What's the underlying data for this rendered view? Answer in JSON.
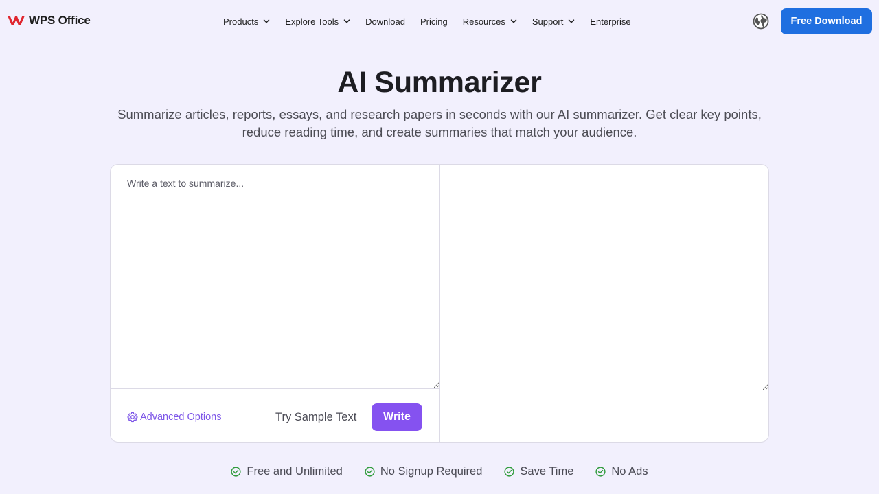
{
  "header": {
    "logo": {
      "text": "WPS Office",
      "icon": "wps-logo-icon",
      "color": "#e0262f"
    },
    "nav": [
      {
        "label": "Products",
        "has_dropdown": true
      },
      {
        "label": "Explore Tools",
        "has_dropdown": true
      },
      {
        "label": "Download",
        "has_dropdown": false
      },
      {
        "label": "Pricing",
        "has_dropdown": false
      },
      {
        "label": "Resources",
        "has_dropdown": true
      },
      {
        "label": "Support",
        "has_dropdown": true
      },
      {
        "label": "Enterprise",
        "has_dropdown": false
      }
    ],
    "language_icon": "globe-icon",
    "cta_label": "Free Download"
  },
  "hero": {
    "title": "AI Summarizer",
    "subtitle": "Summarize articles, reports, essays, and research papers in seconds with our AI summarizer. Get clear key points, reduce reading time, and create summaries that match your audience."
  },
  "editor": {
    "input": {
      "value": "",
      "placeholder": "Write a text to summarize..."
    },
    "output": {
      "value": ""
    },
    "advanced_label": "Advanced Options",
    "sample_label": "Try Sample Text",
    "write_label": "Write"
  },
  "features": [
    {
      "label": "Free and Unlimited",
      "icon": "check-circle-icon"
    },
    {
      "label": "No Signup Required",
      "icon": "check-circle-icon"
    },
    {
      "label": "Save Time",
      "icon": "check-circle-icon"
    },
    {
      "label": "No Ads",
      "icon": "check-circle-icon"
    }
  ],
  "colors": {
    "background": "#f2f0fd",
    "primary_blue": "#1f6fe0",
    "accent_purple": "#8552f0",
    "check_green": "#2e9b3a"
  }
}
